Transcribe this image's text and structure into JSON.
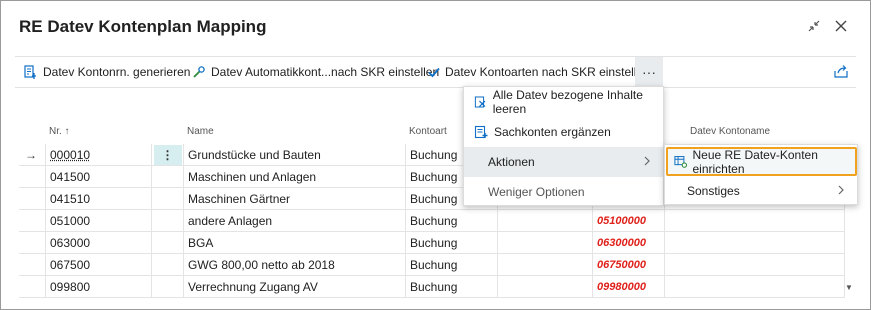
{
  "window": {
    "title": "RE Datev Kontenplan Mapping",
    "colors": {
      "accent": "#0f6fc6",
      "highlight_border": "#f0a21f",
      "red_value": "#e0211b",
      "row_action_bg": "#d7eef0"
    }
  },
  "toolbar": {
    "generate_label": "Datev Kontonrn. generieren",
    "auto_label": "Datev Automatikkont...nach SKR einstellen",
    "types_label": "Datev Kontoarten nach SKR einstellen",
    "more_label": "···"
  },
  "grid": {
    "headers": {
      "nr": "Nr. ↑",
      "name": "Name",
      "kontoart": "Kontoart",
      "datev_kontoname": "Datev Kontoname"
    },
    "row_action_label": "⋮",
    "current_row_marker": "→",
    "rows": [
      {
        "nr": "000010",
        "name": "Grundstücke und Bauten",
        "kontoart": "Buchung",
        "datev": ""
      },
      {
        "nr": "041500",
        "name": "Maschinen und Anlagen",
        "kontoart": "Buchung",
        "datev": ""
      },
      {
        "nr": "041510",
        "name": "Maschinen Gärtner",
        "kontoart": "Buchung",
        "datev": ""
      },
      {
        "nr": "051000",
        "name": "andere Anlagen",
        "kontoart": "Buchung",
        "datev": "05100000"
      },
      {
        "nr": "063000",
        "name": "BGA",
        "kontoart": "Buchung",
        "datev": "06300000"
      },
      {
        "nr": "067500",
        "name": "GWG 800,00 netto ab 2018",
        "kontoart": "Buchung",
        "datev": "06750000"
      },
      {
        "nr": "099800",
        "name": "Verrechnung Zugang AV",
        "kontoart": "Buchung",
        "datev": "09980000"
      }
    ]
  },
  "menu": {
    "clear_label": "Alle Datev bezogene Inhalte leeren",
    "complete_label": "Sachkonten ergänzen",
    "actions_label": "Aktionen",
    "fewer_label": "Weniger Optionen",
    "submenu": {
      "new_accounts_label": "Neue RE Datev-Konten einrichten",
      "misc_label": "Sonstiges"
    }
  }
}
